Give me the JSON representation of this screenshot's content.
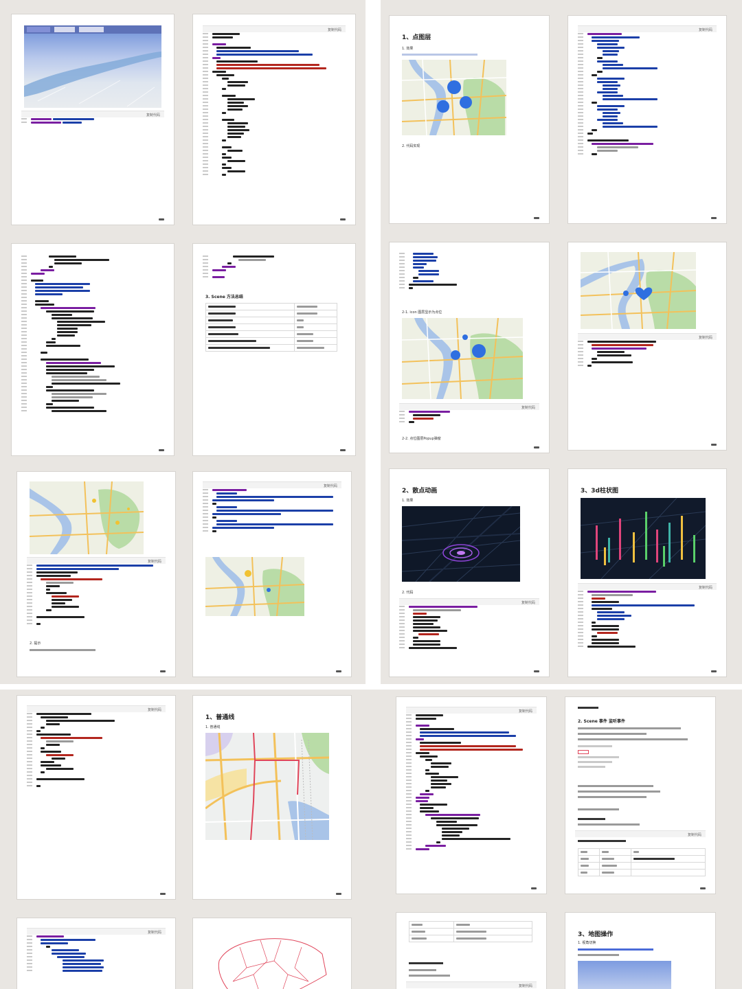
{
  "colors": {
    "background": "#e9e6e2",
    "page": "#ffffff",
    "code_keyword": "#7a1ea1",
    "code_string": "#1b3fa8",
    "code_red": "#b3261e",
    "code_plain": "#222222",
    "map_water": "#a9c4e8",
    "map_park": "#b9dca7",
    "map_road": "#f3c15a",
    "point_blue": "#2f6fe0",
    "point_yellow": "#f1c232"
  },
  "pages": {
    "p03": {
      "heading": "1、点图层",
      "sub1": "1. 效果",
      "sub2": "2. 代码实现"
    },
    "p07": {
      "sub1": "2-1. icon 图层显示为点位",
      "sub2": "2-2. 点位图层Popup弹窗"
    },
    "p06": {
      "heading": "3. Scene 方法总结"
    },
    "p09": {
      "sub1": "2. 提示"
    },
    "p11": {
      "heading": "2、散点动画",
      "sub1": "1. 效果",
      "sub2": "2. 代码"
    },
    "p12": {
      "heading": "3、3d柱状图"
    },
    "p14": {
      "heading": "1、普通线",
      "sub1": "1. 普通线"
    },
    "p16": {
      "heading": "2. Scene 事件 监听事件"
    },
    "p20": {
      "heading": "3、地图操作",
      "sub1": "1. 视角切换"
    }
  },
  "copy_label": "复制代码",
  "icons": [
    "copy-icon",
    "map-marker-icon",
    "expand-icon"
  ]
}
